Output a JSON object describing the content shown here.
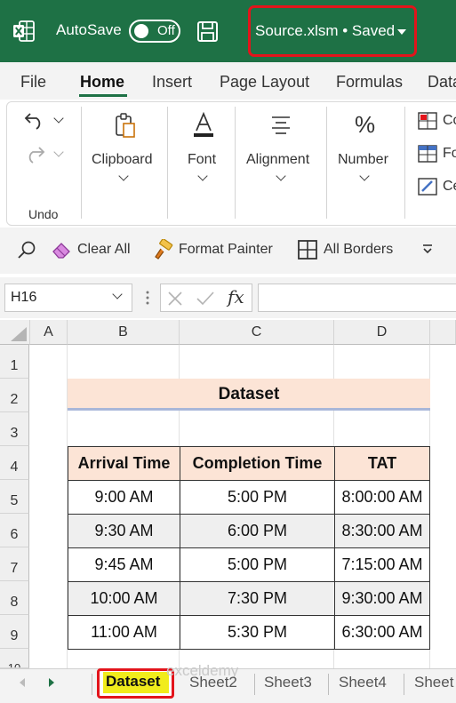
{
  "titlebar": {
    "autosave_label": "AutoSave",
    "autosave_state": "Off",
    "filename": "Source.xlsm • Saved",
    "accent": "#1e7145",
    "highlight_border": "#e3141b"
  },
  "ribbon_tabs": [
    "File",
    "Home",
    "Insert",
    "Page Layout",
    "Formulas",
    "Data"
  ],
  "active_tab": "Home",
  "ribbon_groups": {
    "undo_label": "Undo",
    "clipboard": "Clipboard",
    "font": "Font",
    "alignment": "Alignment",
    "number": "Number",
    "styles_partial": [
      "Co",
      "Fo",
      "Ce"
    ]
  },
  "qat": {
    "clear_all": "Clear All",
    "format_painter": "Format Painter",
    "all_borders": "All Borders"
  },
  "formula_bar": {
    "name_box": "H16",
    "fx": "fx",
    "formula": ""
  },
  "grid": {
    "columns": [
      "A",
      "B",
      "C",
      "D"
    ],
    "rows": [
      "1",
      "2",
      "3",
      "4",
      "5",
      "6",
      "7",
      "8",
      "9",
      "10"
    ],
    "title": "Dataset",
    "table": {
      "headers": [
        "Arrival Time",
        "Completion Time",
        "TAT"
      ],
      "rows": [
        [
          "9:00 AM",
          "5:00 PM",
          "8:00:00 AM"
        ],
        [
          "9:30 AM",
          "6:00 PM",
          "8:30:00 AM"
        ],
        [
          "9:45 AM",
          "5:00 PM",
          "7:15:00 AM"
        ],
        [
          "10:00 AM",
          "7:30 PM",
          "9:30:00 AM"
        ],
        [
          "11:00 AM",
          "5:30 PM",
          "6:30:00 AM"
        ]
      ]
    }
  },
  "sheet_tabs": [
    "Dataset",
    "Sheet2",
    "Sheet3",
    "Sheet4",
    "Sheet"
  ],
  "active_sheet": "Dataset",
  "watermark": "exceldemy"
}
